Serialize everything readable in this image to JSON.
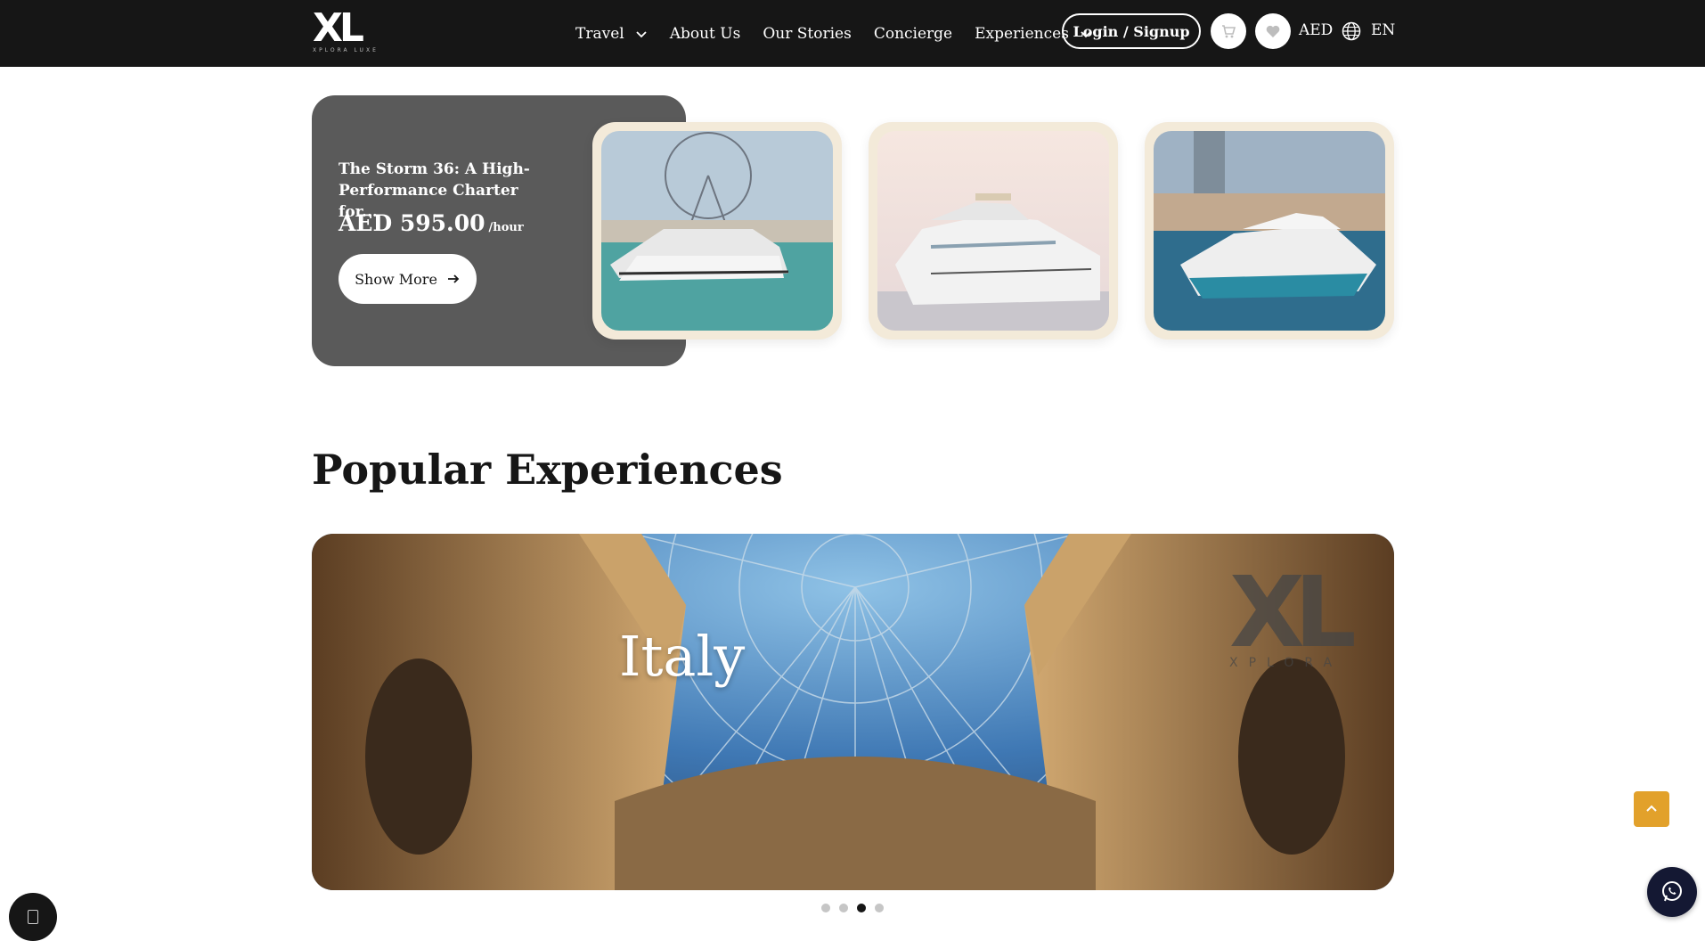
{
  "header": {
    "logo_text": "XL",
    "logo_subtext": "XPLORA LUXE",
    "nav": [
      {
        "label": "Travel",
        "has_dropdown": true
      },
      {
        "label": "About Us",
        "has_dropdown": false
      },
      {
        "label": "Our Stories",
        "has_dropdown": false
      },
      {
        "label": "Concierge",
        "has_dropdown": false
      },
      {
        "label": "Experiences",
        "has_dropdown": true
      }
    ],
    "login_label": "Login / Signup",
    "cart_icon": "cart-icon",
    "wishlist_icon": "heart-icon",
    "currency": "AED",
    "language_icon": "globe-icon",
    "language": "EN"
  },
  "featured": {
    "title": "The Storm 36: A High-Performance Charter for...",
    "price": "AED 595.00",
    "price_unit": "/hour",
    "cta_label": "Show More",
    "cta_icon": "arrow-right-icon"
  },
  "yachts": [
    {
      "name": "yacht-photo-1"
    },
    {
      "name": "yacht-photo-2"
    },
    {
      "name": "yacht-photo-3"
    }
  ],
  "popular": {
    "heading": "Popular Experiences",
    "banner_label": "Italy",
    "watermark_text": "XL",
    "watermark_subtext": "XPLORA",
    "slides_total": 4,
    "active_slide": 3
  },
  "floating": {
    "scroll_top_icon": "chevron-up-icon",
    "whatsapp_icon": "whatsapp-icon",
    "chat_icon": "chat-icon"
  },
  "colors": {
    "nav_bg": "#161616",
    "card_bg": "#5a5a5a",
    "frame_bg": "#f3ead9",
    "accent_orange": "#e2a12b",
    "whatsapp_bg": "#141833"
  }
}
